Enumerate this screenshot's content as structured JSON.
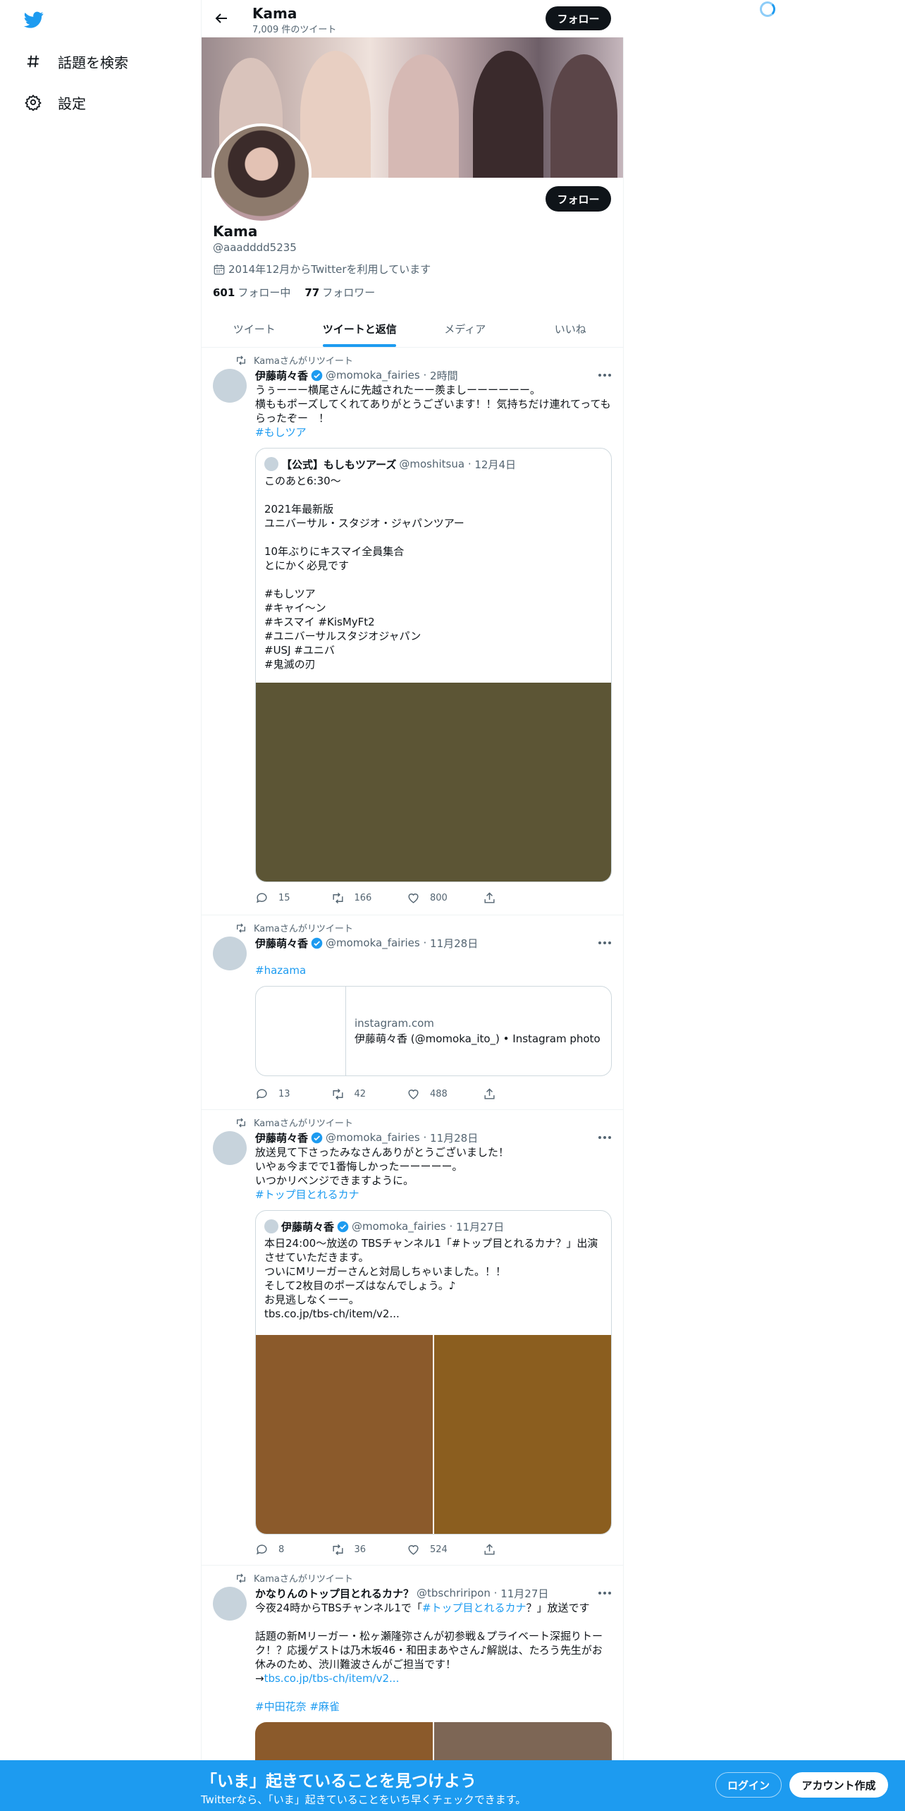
{
  "sidebar": {
    "items": [
      {
        "label": "話題を検索",
        "icon": "hashtag-icon"
      },
      {
        "label": "設定",
        "icon": "gear-icon"
      }
    ]
  },
  "header": {
    "title": "Kama",
    "tweet_count": "7,009 件のツイート",
    "follow_label": "フォロー"
  },
  "profile": {
    "name": "Kama",
    "handle": "@aaadddd5235",
    "joined": "2014年12月からTwitterを利用しています",
    "following_count": "601",
    "following_label": "フォロー中",
    "followers_count": "77",
    "followers_label": "フォロワー",
    "follow_label": "フォロー"
  },
  "tabs": [
    {
      "label": "ツイート",
      "active": false
    },
    {
      "label": "ツイートと返信",
      "active": true
    },
    {
      "label": "メディア",
      "active": false
    },
    {
      "label": "いいね",
      "active": false
    }
  ],
  "tweets": [
    {
      "retweet_line": "Kamaさんがリツイート",
      "name": "伊藤萌々香",
      "handle": "@momoka_fairies",
      "time": "2時間",
      "text": "うぅーーー横尾さんに先越されたーー羨ましーーーーーー。\n横ももポーズしてくれてありがとうございます！！気持ちだけ連れてってもらったぞー　！",
      "hashtag": "#もしツア",
      "quote": {
        "name": "【公式】もしもツアーズ",
        "handle": "@moshitsua",
        "time": "12月4日",
        "text": "このあと6:30〜\n\n2021年最新版\nユニバーサル・スタジオ・ジャパンツアー\n\n10年ぶりにキスマイ全員集合\nとにかく必見です\n\n#もしツア\n#キャイ〜ン\n#キスマイ #KisMyFt2\n#ユニバーサルスタジオジャパン\n#USJ #ユニバ\n#鬼滅の刃"
      },
      "replies": "15",
      "retweets": "166",
      "likes": "800"
    },
    {
      "retweet_line": "Kamaさんがリツイート",
      "name": "伊藤萌々香",
      "handle": "@momoka_fairies",
      "time": "11月28日",
      "hashtag": "#hazama",
      "link": {
        "domain": "instagram.com",
        "title": "伊藤萌々香 (@momoka_ito_) • Instagram photo"
      },
      "replies": "13",
      "retweets": "42",
      "likes": "488"
    },
    {
      "retweet_line": "Kamaさんがリツイート",
      "name": "伊藤萌々香",
      "handle": "@momoka_fairies",
      "time": "11月28日",
      "text": "放送見て下さったみなさんありがとうございました！\nいやぁ今までで1番悔しかったーーーーー。\nいつかリベンジできますように。",
      "hashtag": "#トップ目とれるカナ",
      "quote": {
        "name": "伊藤萌々香",
        "handle": "@momoka_fairies",
        "time": "11月27日",
        "text": "本日24:00〜放送の TBSチャンネル1「#トップ目とれるカナ？」出演させていただきます。\nついにMリーガーさんと対局しちゃいました。！！\nそして2枚目のポーズはなんでしょう。♪\nお見逃しなくーー。\ntbs.co.jp/tbs-ch/item/v2..."
      },
      "replies": "8",
      "retweets": "36",
      "likes": "524"
    },
    {
      "retweet_line": "Kamaさんがリツイート",
      "name": "かなりんのトップ目とれるカナ？",
      "handle": "@tbschriripon",
      "time": "11月27日",
      "text_pre": "今夜24時からTBSチャンネル1で「",
      "text_link": "#トップ目とれるカナ",
      "text_post": "？」放送です",
      "text2": "話題の新Mリーガー・松ヶ瀬隆弥さんが初参戦＆プライベート深掘りトーク！？応援ゲストは乃木坂46・和田まあやさん♪解説は、たろう先生がお休みのため、渋川難波さんがご担当です！",
      "link_prefix": "→",
      "link_text": "tbs.co.jp/tbs-ch/item/v2...",
      "hashtags": "#中田花奈 #麻雀"
    }
  ],
  "bottom": {
    "title": "「いま」起きていることを見つけよう",
    "subtitle": "Twitterなら、「いま」起きていることをいち早くチェックできます。",
    "login": "ログイン",
    "signup": "アカウント作成"
  },
  "colors": {
    "accent": "#1d9bf0",
    "text": "#0f1419",
    "secondary": "#536471",
    "media1": "#5c5535",
    "media2a": "#8b5a2b",
    "media2b": "#8b5e1f"
  }
}
